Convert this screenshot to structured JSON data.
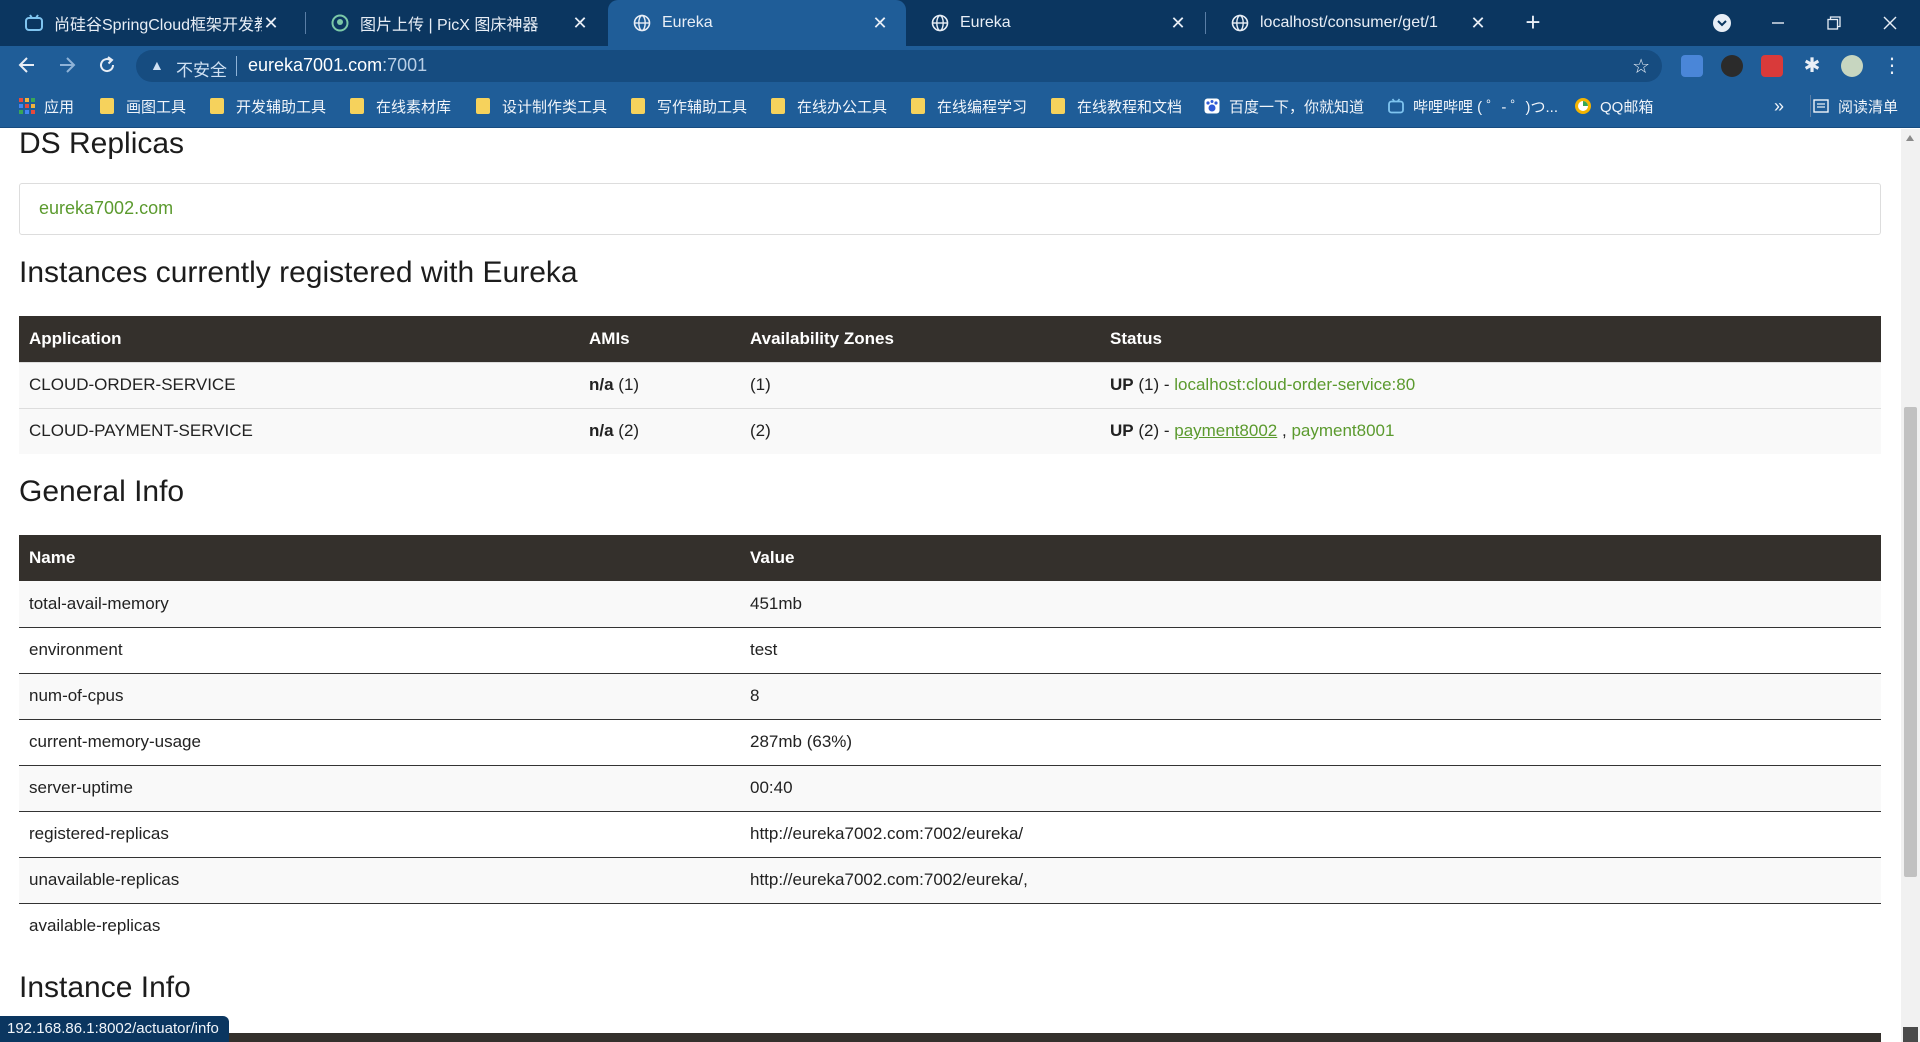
{
  "browser": {
    "tabs": [
      {
        "title": "尚硅谷SpringCloud框架开发教程",
        "icon": "bilibili-icon",
        "active": false
      },
      {
        "title": "图片上传 | PicX 图床神器",
        "icon": "picx-icon",
        "active": false
      },
      {
        "title": "Eureka",
        "icon": "globe-icon",
        "active": true
      },
      {
        "title": "Eureka",
        "icon": "globe-icon",
        "active": false
      },
      {
        "title": "localhost/consumer/get/1",
        "icon": "globe-icon",
        "active": false
      }
    ],
    "address": {
      "security_label": "不安全",
      "host": "eureka7001.com",
      "port": ":7001"
    },
    "bookmarks": [
      {
        "label": "应用",
        "icon": "apps-grid-icon"
      },
      {
        "label": "画图工具",
        "icon": "folder-icon"
      },
      {
        "label": "开发辅助工具",
        "icon": "folder-icon"
      },
      {
        "label": "在线素材库",
        "icon": "folder-icon"
      },
      {
        "label": "设计制作类工具",
        "icon": "folder-icon"
      },
      {
        "label": "写作辅助工具",
        "icon": "folder-icon"
      },
      {
        "label": "在线办公工具",
        "icon": "folder-icon"
      },
      {
        "label": "在线编程学习",
        "icon": "folder-icon"
      },
      {
        "label": "在线教程和文档",
        "icon": "folder-icon"
      },
      {
        "label": "百度一下，你就知道",
        "icon": "baidu-icon"
      },
      {
        "label": "哔哩哔哩 ( ゜- ゜)つ...",
        "icon": "bilibili-icon"
      },
      {
        "label": "QQ邮箱",
        "icon": "qqmail-icon"
      }
    ],
    "bookmarks_more": "»",
    "reading_list": "阅读清单",
    "status_url": "192.168.86.1:8002/actuator/info"
  },
  "page": {
    "ds_replicas": {
      "title": "DS Replicas",
      "items": [
        "eureka7002.com"
      ]
    },
    "instances": {
      "title": "Instances currently registered with Eureka",
      "columns": [
        "Application",
        "AMIs",
        "Availability Zones",
        "Status"
      ],
      "rows": [
        {
          "application": "CLOUD-ORDER-SERVICE",
          "amis_bold": "n/a",
          "amis_count": " (1)",
          "zones": "(1)",
          "status_bold": "UP",
          "status_count": " (1) - ",
          "links": [
            "localhost:cloud-order-service:80"
          ]
        },
        {
          "application": "CLOUD-PAYMENT-SERVICE",
          "amis_bold": "n/a",
          "amis_count": " (2)",
          "zones": "(2)",
          "status_bold": "UP",
          "status_count": " (2) - ",
          "links": [
            "payment8002",
            "payment8001"
          ]
        }
      ]
    },
    "general_info": {
      "title": "General Info",
      "columns": [
        "Name",
        "Value"
      ],
      "rows": [
        {
          "name": "total-avail-memory",
          "value": "451mb"
        },
        {
          "name": "environment",
          "value": "test"
        },
        {
          "name": "num-of-cpus",
          "value": "8"
        },
        {
          "name": "current-memory-usage",
          "value": "287mb (63%)"
        },
        {
          "name": "server-uptime",
          "value": "00:40"
        },
        {
          "name": "registered-replicas",
          "value": "http://eureka7002.com:7002/eureka/"
        },
        {
          "name": "unavailable-replicas",
          "value": "http://eureka7002.com:7002/eureka/,"
        },
        {
          "name": "available-replicas",
          "value": ""
        }
      ]
    },
    "instance_info": {
      "title": "Instance Info"
    }
  },
  "colors": {
    "tabstrip": "#0b3660",
    "toolbar": "#1f5d98",
    "table_header": "#34302c",
    "link_green": "#5b9a2e"
  }
}
